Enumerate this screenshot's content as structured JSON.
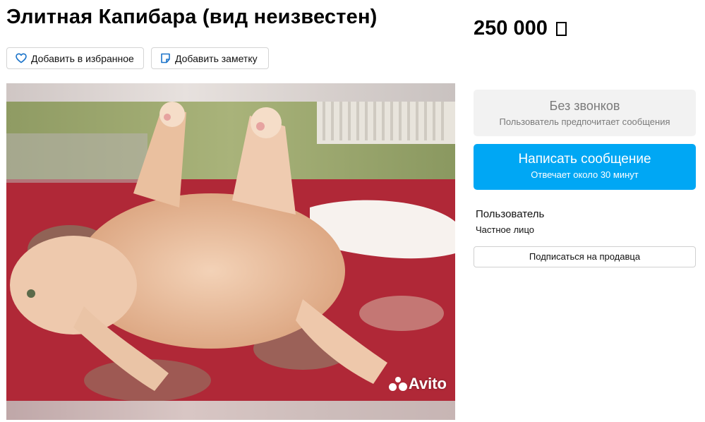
{
  "listing": {
    "title": "Элитная Капибара (вид неизвестен)",
    "price": "250 000"
  },
  "actions": {
    "favorite_label": "Добавить в избранное",
    "note_label": "Добавить заметку"
  },
  "gallery": {
    "watermark": "Avito"
  },
  "contact": {
    "no_calls_title": "Без звонков",
    "no_calls_subtitle": "Пользователь предпочитает сообщения",
    "message_button_label": "Написать сообщение",
    "message_button_subtitle": "Отвечает около 30 минут"
  },
  "seller": {
    "name": "Пользователь",
    "type": "Частное лицо",
    "subscribe_label": "Подписаться на продавца"
  },
  "icons": {
    "favorite": "heart-icon",
    "note": "note-icon",
    "currency": "ruble-icon"
  },
  "colors": {
    "accent": "#00a7f4",
    "muted_panel": "#f2f2f2"
  }
}
